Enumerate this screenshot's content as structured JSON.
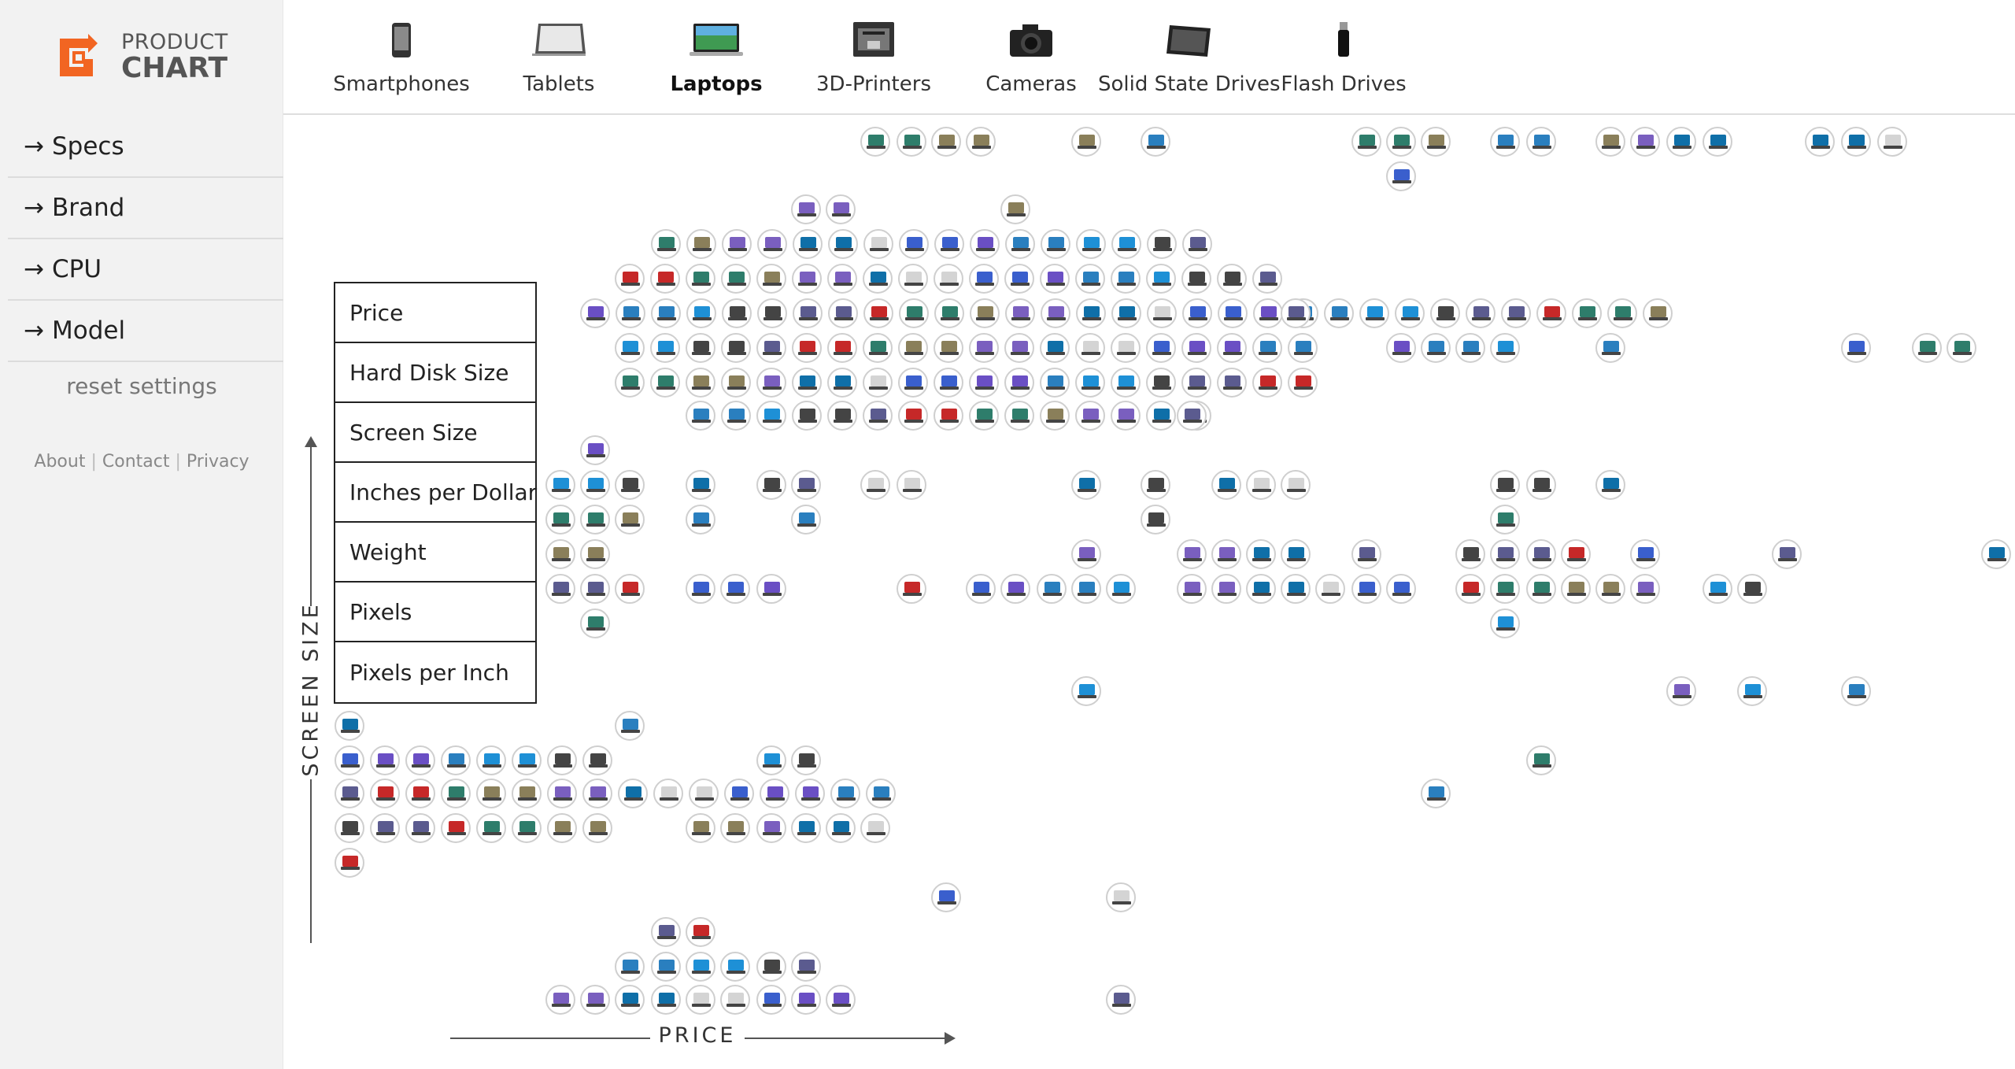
{
  "logo": {
    "line1": "PRODUCT",
    "line2": "CHART",
    "color": "#f26522"
  },
  "categories": [
    {
      "label": "Smartphones",
      "icon": "smartphone-icon",
      "active": false
    },
    {
      "label": "Tablets",
      "icon": "tablet-icon",
      "active": false
    },
    {
      "label": "Laptops",
      "icon": "laptop-icon",
      "active": true
    },
    {
      "label": "3D-Printers",
      "icon": "3d-printer-icon",
      "active": false
    },
    {
      "label": "Cameras",
      "icon": "camera-icon",
      "active": false
    },
    {
      "label": "Solid State Drives",
      "icon": "ssd-icon",
      "active": false
    },
    {
      "label": "Flash Drives",
      "icon": "flash-drive-icon",
      "active": false
    }
  ],
  "sidebar": {
    "arrow": "→",
    "filters": [
      "Specs",
      "Brand",
      "CPU",
      "Model"
    ],
    "reset_label": "reset settings",
    "links": [
      "About",
      "Contact",
      "Privacy"
    ]
  },
  "axes": {
    "y_label": "SCREEN SIZE",
    "x_label": "PRICE"
  },
  "axis_menu": {
    "options": [
      "Price",
      "Hard Disk Size",
      "Screen Size",
      "Inches per Dollar",
      "Weight",
      "Pixels",
      "Pixels per Inch"
    ]
  }
}
